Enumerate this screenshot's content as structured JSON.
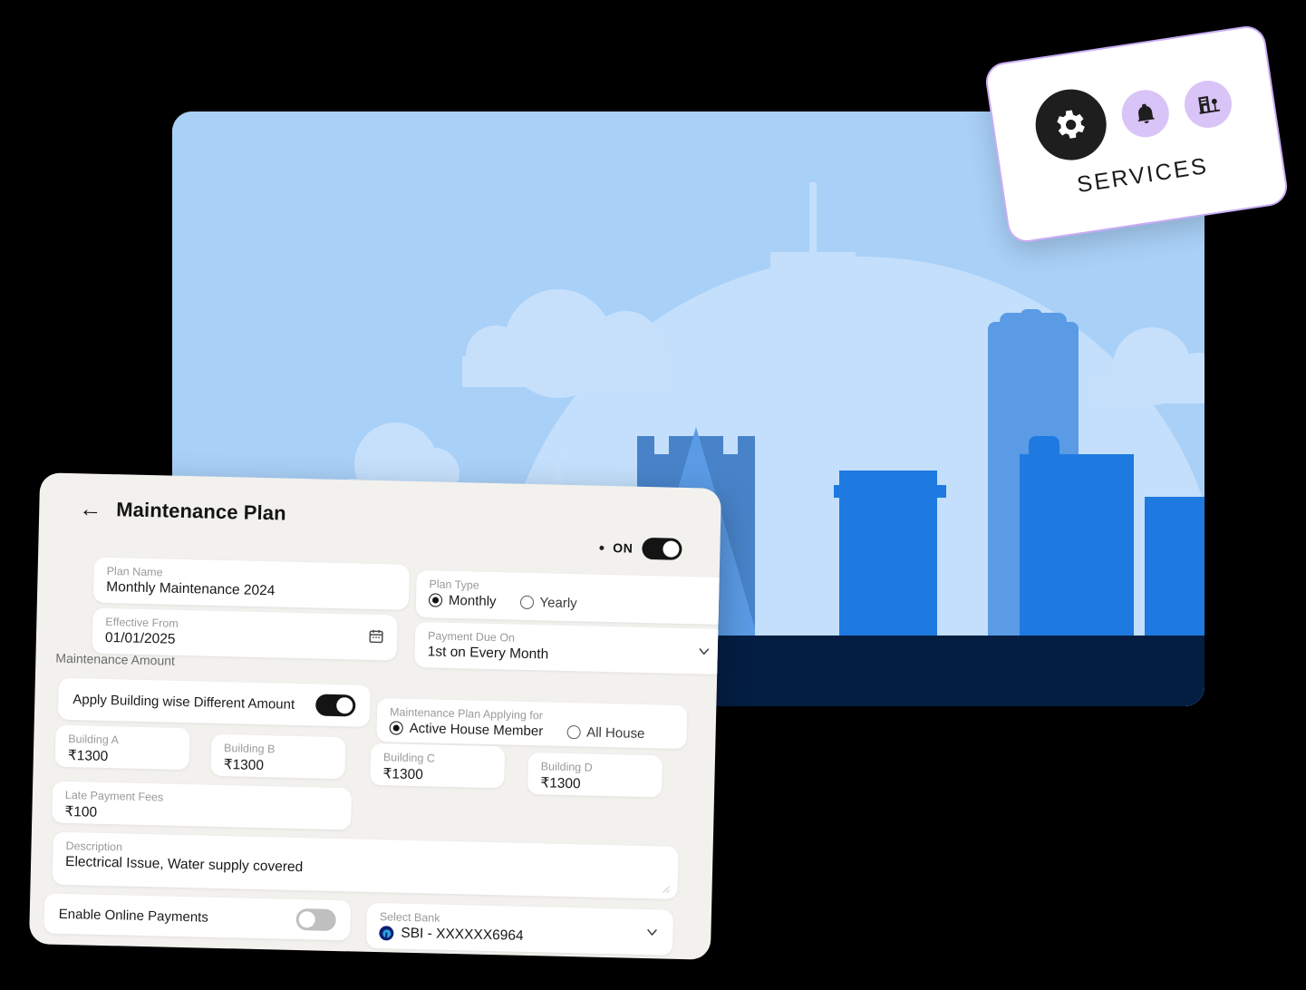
{
  "services_card": {
    "label": "SERVICES",
    "icons": [
      "gear-icon",
      "bell-icon",
      "building-icon"
    ],
    "accent_border": "#C9ACF5",
    "icon_bg": "#D9C4F7",
    "main_icon_bg": "#1E1E1E"
  },
  "illustration": {
    "name": "city-skyline-illustration",
    "colors": {
      "sky": "#A9D0F7",
      "sun": "#C3DFFB",
      "cloud": "#C6E0FC",
      "building_pale": "#C3DFFB",
      "building_mid": "#5B9BE5",
      "building_dark_mid": "#4883C9",
      "building_blue": "#1E7AE0",
      "ground_navy": "#041E42"
    }
  },
  "form": {
    "title": "Maintenance Plan",
    "back_icon": "←",
    "status": {
      "label": "ON",
      "enabled": true
    },
    "fields": {
      "plan_name": {
        "label": "Plan Name",
        "value": "Monthly Maintenance 2024"
      },
      "effective_from": {
        "label": "Effective From",
        "value": "01/01/2025",
        "icon": "calendar-icon"
      },
      "plan_type": {
        "label": "Plan Type",
        "options": [
          "Monthly",
          "Yearly"
        ],
        "selected": "Monthly"
      },
      "payment_due_on": {
        "label": "Payment Due On",
        "value": "1st on Every Month",
        "icon": "chevron-down-icon"
      },
      "maintenance_amount_heading": "Maintenance Amount",
      "apply_building_wise": {
        "label": "Apply Building wise Different Amount",
        "enabled": true
      },
      "applying_for": {
        "label": "Maintenance Plan Applying for",
        "options": [
          "Active House Member",
          "All House"
        ],
        "selected": "Active House Member"
      },
      "buildings": [
        {
          "label": "Building A",
          "value": "₹1300"
        },
        {
          "label": "Building B",
          "value": "₹1300"
        },
        {
          "label": "Building C",
          "value": "₹1300"
        },
        {
          "label": "Building D",
          "value": "₹1300"
        }
      ],
      "late_payment_fees": {
        "label": "Late Payment Fees",
        "value": "₹100"
      },
      "description": {
        "label": "Description",
        "value": "Electrical Issue, Water supply covered"
      },
      "enable_online_payments": {
        "label": "Enable Online Payments",
        "enabled": false
      },
      "select_bank": {
        "label": "Select Bank",
        "value": "SBI - XXXXXX6964",
        "icon": "chevron-down-icon",
        "bank_icon": "sbi-logo"
      }
    }
  }
}
